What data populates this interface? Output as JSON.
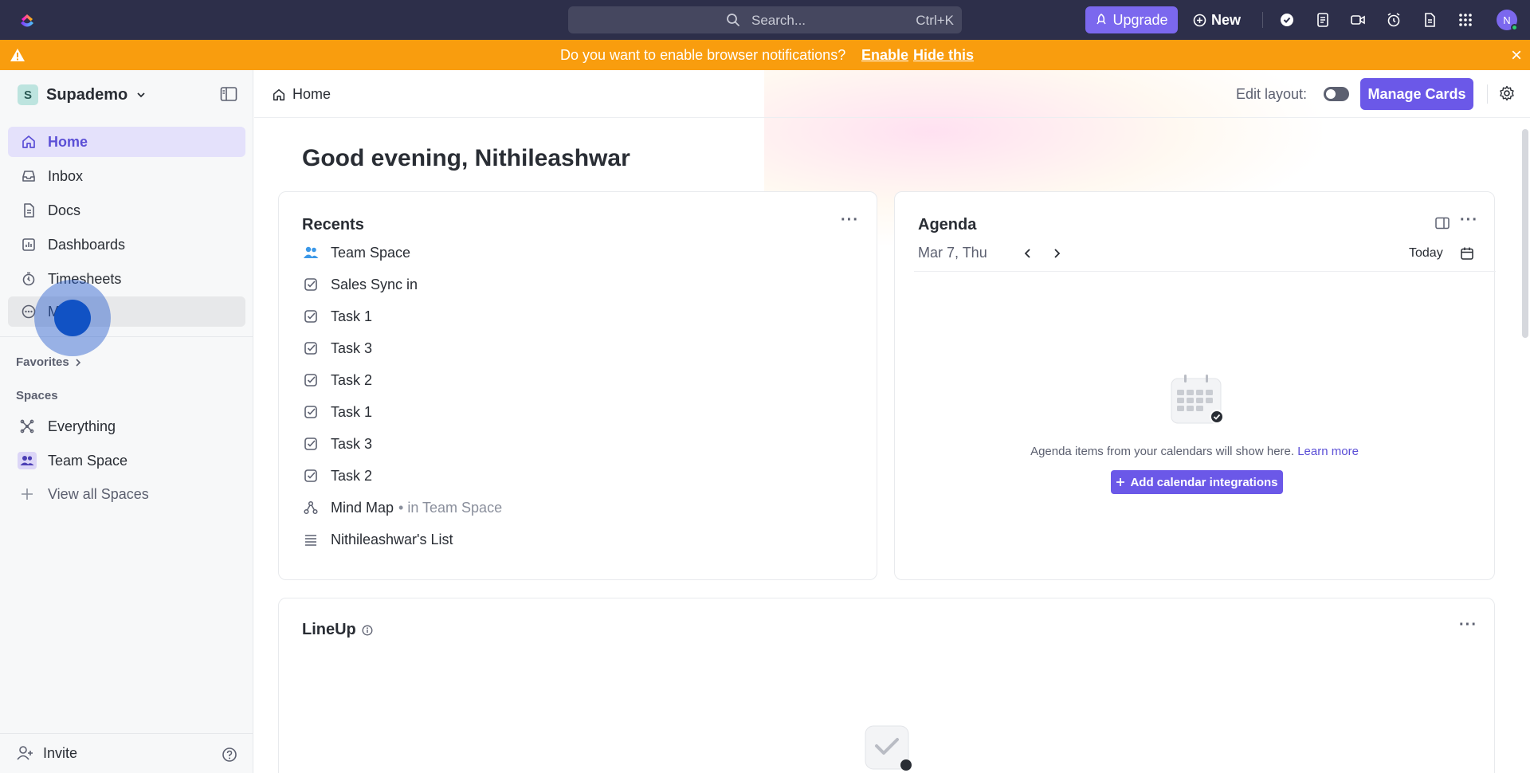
{
  "topbar": {
    "search_placeholder": "Search...",
    "search_shortcut": "Ctrl+K",
    "upgrade_label": "Upgrade",
    "new_label": "New",
    "avatar_initial": "N"
  },
  "banner": {
    "message": "Do you want to enable browser notifications?",
    "enable_label": "Enable",
    "hide_label": "Hide this"
  },
  "sidebar": {
    "workspace_initial": "S",
    "workspace_name": "Supademo",
    "nav": [
      {
        "label": "Home",
        "icon": "home-icon"
      },
      {
        "label": "Inbox",
        "icon": "inbox-icon"
      },
      {
        "label": "Docs",
        "icon": "docs-icon"
      },
      {
        "label": "Dashboards",
        "icon": "dashboards-icon"
      },
      {
        "label": "Timesheets",
        "icon": "timesheets-icon"
      },
      {
        "label": "More",
        "icon": "more-icon"
      }
    ],
    "favorites_label": "Favorites",
    "spaces_label": "Spaces",
    "spaces": [
      {
        "label": "Everything",
        "icon": "everything-icon"
      },
      {
        "label": "Team Space",
        "icon": "team-space-icon"
      },
      {
        "label": "View all Spaces",
        "icon": "plus-icon"
      }
    ],
    "invite_label": "Invite"
  },
  "main": {
    "breadcrumb": "Home",
    "edit_layout_label": "Edit layout:",
    "manage_cards_label": "Manage Cards",
    "greeting": "Good evening, Nithileashwar"
  },
  "recents": {
    "title": "Recents",
    "items": [
      {
        "label": "Team Space",
        "location": "",
        "icon": "team-icon"
      },
      {
        "label": "Sales Sync in",
        "location": "",
        "icon": "task-check-icon"
      },
      {
        "label": "Task 1",
        "location": "",
        "icon": "task-check-icon"
      },
      {
        "label": "Task 3",
        "location": "",
        "icon": "task-check-icon"
      },
      {
        "label": "Task 2",
        "location": "",
        "icon": "task-check-icon"
      },
      {
        "label": "Task 1",
        "location": "",
        "icon": "task-check-icon"
      },
      {
        "label": "Task 3",
        "location": "",
        "icon": "task-check-icon"
      },
      {
        "label": "Task 2",
        "location": "",
        "icon": "task-check-icon"
      },
      {
        "label": "Mind Map",
        "location": "• in Team Space",
        "icon": "mind-map-icon"
      },
      {
        "label": "Nithileashwar's List",
        "location": "",
        "icon": "list-icon"
      }
    ]
  },
  "agenda": {
    "title": "Agenda",
    "date": "Mar 7, Thu",
    "today_label": "Today",
    "empty_text": "Agenda items from your calendars will show here.",
    "learn_more": "Learn more",
    "add_label": "Add calendar integrations"
  },
  "lineup": {
    "title": "LineUp"
  },
  "colors": {
    "accent": "#7b68ee",
    "banner": "#f99d0e",
    "topbar": "#2d2f4a"
  }
}
